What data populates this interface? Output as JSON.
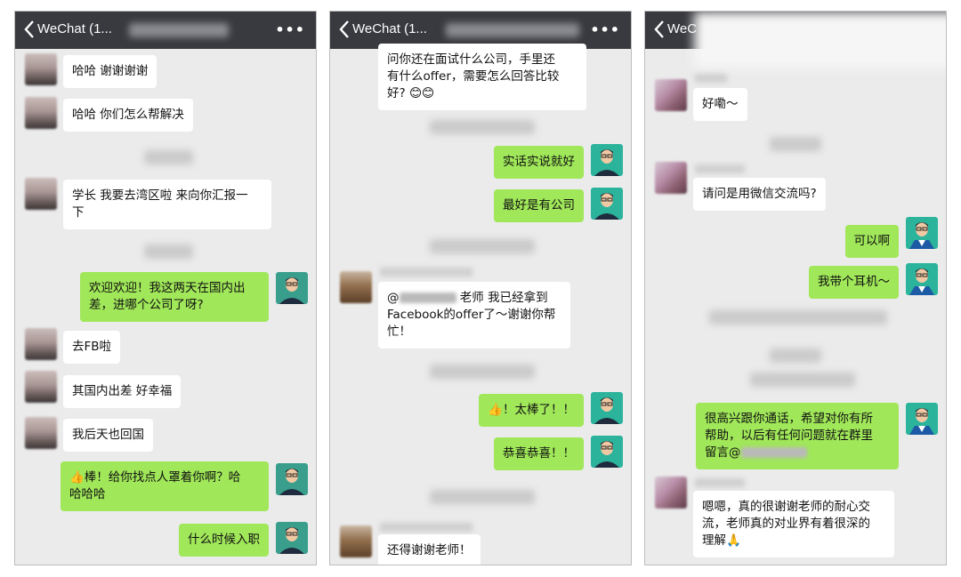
{
  "panels": [
    {
      "back_title": "WeChat (1...",
      "more": "•••",
      "messages": [
        {
          "side": "left",
          "text": "哈哈 谢谢谢谢"
        },
        {
          "side": "left",
          "text": "哈哈 你们怎么帮解决"
        },
        {
          "side": "left",
          "text": "学长 我要去湾区啦 来向你汇报一\n下"
        },
        {
          "side": "right",
          "text": "欢迎欢迎！我这两天在国内出\n差，进哪个公司了呀?"
        },
        {
          "side": "left",
          "text": "去FB啦"
        },
        {
          "side": "left",
          "text": "其国内出差 好幸福"
        },
        {
          "side": "left",
          "text": "我后天也回国"
        },
        {
          "side": "right",
          "text": "👍棒！给你找点人罩着你啊？哈\n哈哈哈"
        },
        {
          "side": "right",
          "text": "什么时候入职"
        }
      ]
    },
    {
      "back_title": "WeChat (1...",
      "more": "•••",
      "messages": [
        {
          "side": "left",
          "text": "问你还在面试什么公司，手里还\n有什么offer，需要怎么回答比较\n好? 😊😊"
        },
        {
          "side": "right",
          "text": "实话实说就好"
        },
        {
          "side": "right",
          "text": "最好是有公司"
        },
        {
          "side": "left",
          "prefix": "@",
          "suffix": " 老师 我已经拿到\nFacebook的offer了～谢谢你帮\n忙！"
        },
        {
          "side": "right",
          "text": "👍！太棒了！！"
        },
        {
          "side": "right",
          "text": "恭喜恭喜！！"
        },
        {
          "side": "left",
          "text": "还得谢谢老师！"
        }
      ]
    },
    {
      "back_title": "WeC",
      "messages": [
        {
          "side": "left",
          "text": "好嘞～"
        },
        {
          "side": "left",
          "text": "请问是用微信交流吗?"
        },
        {
          "side": "right",
          "text": "可以啊"
        },
        {
          "side": "right",
          "text": "我带个耳机～"
        },
        {
          "side": "right",
          "prefix": "很高兴跟你通话，希望对你有所\n帮助，以后有任何问题就在群里\n留言@",
          "suffix": ""
        },
        {
          "side": "left",
          "text": "嗯嗯，真的很谢谢老师的耐心交\n流，老师真的对业界有着很深的\n理解🙏"
        }
      ]
    }
  ],
  "colors": {
    "topbar": "#393a3f",
    "chat_bg": "#ebebeb",
    "bubble_right": "#a0e759",
    "bubble_left": "#ffffff"
  }
}
